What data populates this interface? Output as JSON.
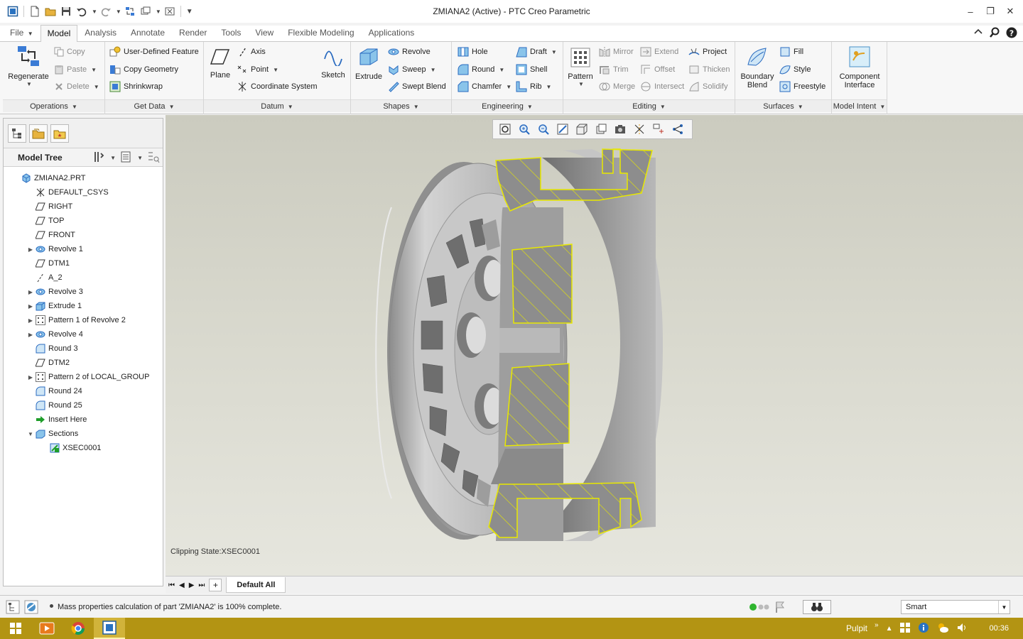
{
  "window": {
    "title": "ZMIANA2 (Active) - PTC Creo Parametric"
  },
  "tabs": [
    {
      "label": "File"
    },
    {
      "label": "Model"
    },
    {
      "label": "Analysis"
    },
    {
      "label": "Annotate"
    },
    {
      "label": "Render"
    },
    {
      "label": "Tools"
    },
    {
      "label": "View"
    },
    {
      "label": "Flexible Modeling"
    },
    {
      "label": "Applications"
    }
  ],
  "ribbon": {
    "operations": {
      "label": "Operations",
      "regenerate": "Regenerate",
      "copy": "Copy",
      "paste": "Paste",
      "delete": "Delete"
    },
    "getdata": {
      "label": "Get Data",
      "udf": "User-Defined Feature",
      "copy_geometry": "Copy Geometry",
      "shrinkwrap": "Shrinkwrap"
    },
    "datum": {
      "label": "Datum",
      "plane": "Plane",
      "axis": "Axis",
      "point": "Point",
      "csys": "Coordinate System",
      "sketch": "Sketch"
    },
    "shapes": {
      "label": "Shapes",
      "extrude": "Extrude",
      "revolve": "Revolve",
      "sweep": "Sweep",
      "swept_blend": "Swept Blend"
    },
    "engineering": {
      "label": "Engineering",
      "hole": "Hole",
      "round": "Round",
      "chamfer": "Chamfer",
      "draft": "Draft",
      "shell": "Shell",
      "rib": "Rib"
    },
    "editing": {
      "label": "Editing",
      "pattern": "Pattern",
      "mirror": "Mirror",
      "trim": "Trim",
      "merge": "Merge",
      "extend": "Extend",
      "offset": "Offset",
      "intersect": "Intersect",
      "project": "Project",
      "thicken": "Thicken",
      "solidify": "Solidify"
    },
    "surfaces": {
      "label": "Surfaces",
      "boundary_blend_1": "Boundary",
      "boundary_blend_2": "Blend",
      "fill": "Fill",
      "style": "Style",
      "freestyle": "Freestyle"
    },
    "model_intent": {
      "label": "Model Intent",
      "ci_1": "Component",
      "ci_2": "Interface"
    }
  },
  "model_tree": {
    "title": "Model Tree",
    "items": [
      {
        "label": "ZMIANA2.PRT",
        "icon": "part-icon",
        "indent": 0,
        "expand": ""
      },
      {
        "label": "DEFAULT_CSYS",
        "icon": "csys-icon",
        "indent": 1,
        "expand": ""
      },
      {
        "label": "RIGHT",
        "icon": "plane-icon",
        "indent": 1,
        "expand": ""
      },
      {
        "label": "TOP",
        "icon": "plane-icon",
        "indent": 1,
        "expand": ""
      },
      {
        "label": "FRONT",
        "icon": "plane-icon",
        "indent": 1,
        "expand": ""
      },
      {
        "label": "Revolve 1",
        "icon": "revolve-icon",
        "indent": 1,
        "expand": "▶"
      },
      {
        "label": "DTM1",
        "icon": "plane-icon",
        "indent": 1,
        "expand": ""
      },
      {
        "label": "A_2",
        "icon": "axis-icon",
        "indent": 1,
        "expand": ""
      },
      {
        "label": "Revolve 3",
        "icon": "revolve-icon",
        "indent": 1,
        "expand": "▶"
      },
      {
        "label": "Extrude 1",
        "icon": "extrude-icon",
        "indent": 1,
        "expand": "▶"
      },
      {
        "label": "Pattern 1 of Revolve 2",
        "icon": "pattern-icon",
        "indent": 1,
        "expand": "▶"
      },
      {
        "label": "Revolve 4",
        "icon": "revolve-icon",
        "indent": 1,
        "expand": "▶"
      },
      {
        "label": "Round 3",
        "icon": "round-icon",
        "indent": 1,
        "expand": ""
      },
      {
        "label": "DTM2",
        "icon": "plane-icon",
        "indent": 1,
        "expand": ""
      },
      {
        "label": "Pattern 2 of LOCAL_GROUP",
        "icon": "pattern-icon",
        "indent": 1,
        "expand": "▶"
      },
      {
        "label": "Round 24",
        "icon": "round-icon",
        "indent": 1,
        "expand": ""
      },
      {
        "label": "Round 25",
        "icon": "round-icon",
        "indent": 1,
        "expand": ""
      },
      {
        "label": "Insert Here",
        "icon": "insert-arrow-icon",
        "indent": 1,
        "expand": ""
      },
      {
        "label": "Sections",
        "icon": "sections-icon",
        "indent": 1,
        "expand": "▼"
      },
      {
        "label": "XSEC0001",
        "icon": "xsec-icon",
        "indent": 2,
        "expand": ""
      }
    ]
  },
  "graphics": {
    "clipping_state": "Clipping State:XSEC0001",
    "window_tab": "Default All",
    "section_color": "#e8e800"
  },
  "status": {
    "message": "Mass properties calculation of part 'ZMIANA2' is 100% complete.",
    "filter": "Smart"
  },
  "taskbar": {
    "desk_label": "Pulpit",
    "clock": "00:36"
  }
}
